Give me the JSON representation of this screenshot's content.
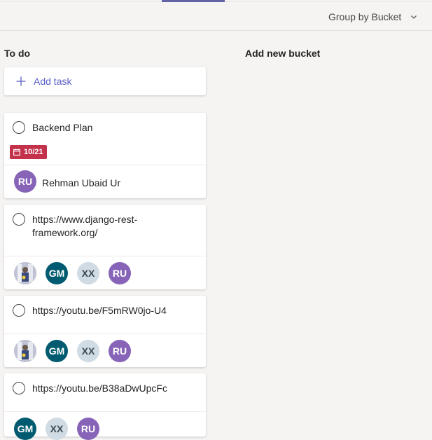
{
  "header": {
    "group_by_label": "Group by Bucket",
    "chevron_icon": "chevron-down-icon"
  },
  "buckets": {
    "todo_title": "To do",
    "add_new_bucket": "Add new bucket"
  },
  "add_task": {
    "label": "Add task",
    "icon": "plus-icon"
  },
  "tasks": [
    {
      "title": "Backend Plan",
      "due": "10/21",
      "assignees": [
        {
          "initials": "RU",
          "name": "Rehman Ubaid Ur"
        }
      ]
    },
    {
      "title": "https://www.django-rest-framework.org/",
      "assignees": [
        {
          "initials": "photo"
        },
        {
          "initials": "GM"
        },
        {
          "initials": "XX"
        },
        {
          "initials": "RU"
        }
      ]
    },
    {
      "title": "https://youtu.be/F5mRW0jo-U4",
      "assignees": [
        {
          "initials": "photo"
        },
        {
          "initials": "GM"
        },
        {
          "initials": "XX"
        },
        {
          "initials": "RU"
        }
      ]
    },
    {
      "title": "https://youtu.be/B38aDwUpcFc",
      "assignees": [
        {
          "initials": "GM"
        },
        {
          "initials": "XX"
        },
        {
          "initials": "RU"
        }
      ]
    }
  ],
  "colors": {
    "accent": "#6264a7",
    "due_badge": "#c4314b",
    "avatar_ru": "#8764b8",
    "avatar_gm": "#005b70",
    "avatar_xx": "#d0dbe3"
  }
}
